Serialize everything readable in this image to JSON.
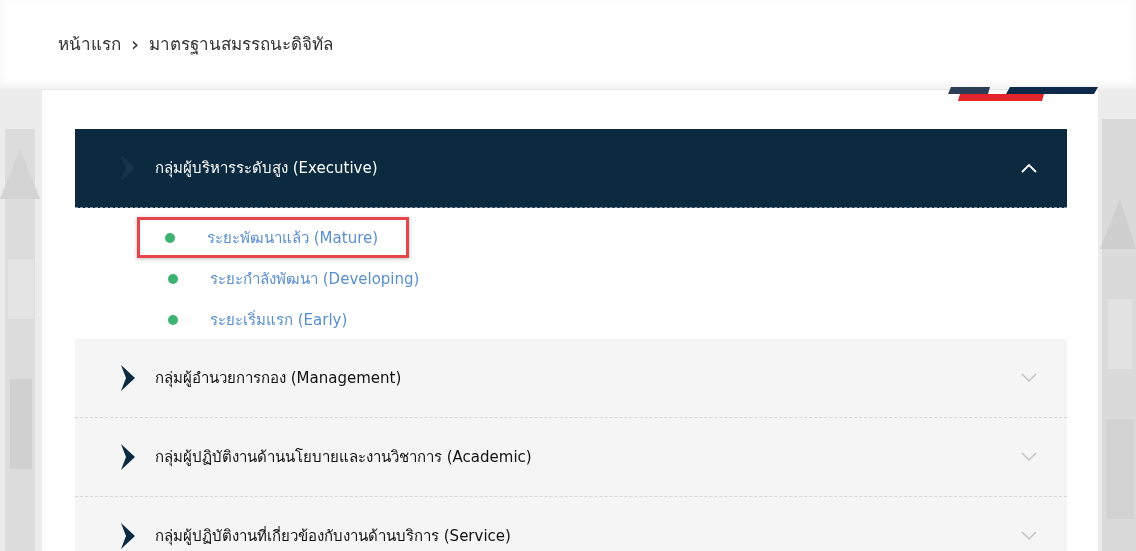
{
  "breadcrumb": [
    {
      "label": "หน้าแรก"
    },
    {
      "label": "มาตรฐานสมรรถนะดิจิทัล"
    }
  ],
  "breadcrumb_separator": "›",
  "groups": [
    {
      "title": "กลุ่มผู้บริหารระดับสูง (Executive)",
      "expanded": true,
      "items": [
        {
          "label": "ระยะพัฒนาแล้ว (Mature)",
          "highlighted": true,
          "color": "#3cb371"
        },
        {
          "label": "ระยะกำลังพัฒนา (Developing)",
          "highlighted": false,
          "color": "#3cb371"
        },
        {
          "label": "ระยะเริ่มแรก (Early)",
          "highlighted": false,
          "color": "#3cb371"
        }
      ]
    },
    {
      "title": "กลุ่มผู้อำนวยการกอง (Management)",
      "expanded": false
    },
    {
      "title": "กลุ่มผู้ปฏิบัติงานด้านนโยบายและงานวิชาการ (Academic)",
      "expanded": false
    },
    {
      "title": "กลุ่มผู้ปฏิบัติงานที่เกี่ยวข้องกับงานด้านบริการ (Service)",
      "expanded": false
    }
  ]
}
